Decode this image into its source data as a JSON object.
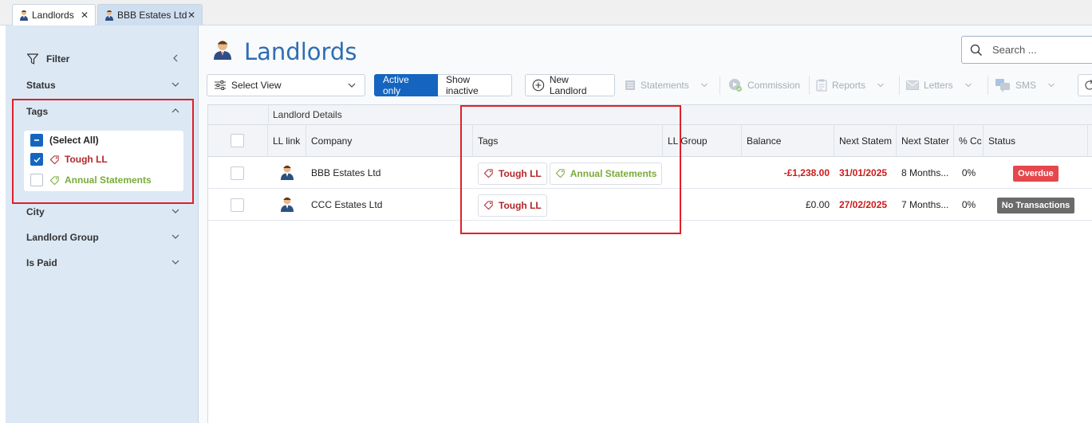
{
  "tabs": [
    {
      "label": "Landlords",
      "close": "✕",
      "active": true
    },
    {
      "label": "BBB Estates Ltd",
      "close": "✕",
      "active": false
    }
  ],
  "sidebar": {
    "filter_label": "Filter",
    "sections": {
      "status": "Status",
      "tags": "Tags",
      "city": "City",
      "landlord_group": "Landlord Group",
      "is_paid": "Is Paid"
    },
    "tag_options": [
      {
        "label": "(Select All)",
        "state": "indeterminate"
      },
      {
        "label": "Tough LL",
        "state": "checked",
        "color": "#b3262a"
      },
      {
        "label": "Annual Statements",
        "state": "unchecked",
        "color": "#7aab3a"
      }
    ]
  },
  "page": {
    "title": "Landlords",
    "search_placeholder": "Search ..."
  },
  "toolbar": {
    "select_view": "Select View",
    "active_only": "Active only",
    "show_inactive": "Show inactive",
    "new_landlord": "New Landlord",
    "statements": "Statements",
    "commission": "Commission",
    "reports": "Reports",
    "letters": "Letters",
    "sms": "SMS"
  },
  "grid": {
    "band_label": "Landlord Details",
    "columns": [
      "LL link",
      "Company",
      "Tags",
      "LL Group",
      "Balance",
      "Next Statem",
      "Next Stater",
      "% Cc",
      "Status"
    ],
    "rows": [
      {
        "company": "BBB Estates Ltd",
        "tags": [
          "Tough LL",
          "Annual Statements"
        ],
        "ll_group": "",
        "balance": "-£1,238.00",
        "next_statement_date": "31/01/2025",
        "next_statement_period": "8 Months...",
        "pct": "0%",
        "status": "Overdue"
      },
      {
        "company": "CCC Estates Ltd",
        "tags": [
          "Tough LL"
        ],
        "ll_group": "",
        "balance": "£0.00",
        "next_statement_date": "27/02/2025",
        "next_statement_period": "7 Months...",
        "pct": "0%",
        "status": "No Transactions"
      }
    ]
  },
  "colors": {
    "accent": "#1565c0",
    "title_blue": "#2f6db3",
    "tag_red": "#b3262a",
    "tag_green": "#7aab3a",
    "overdue_badge": "#e5474d",
    "no_tx_badge": "#6b6b6b",
    "highlight_box": "#e0202a"
  }
}
